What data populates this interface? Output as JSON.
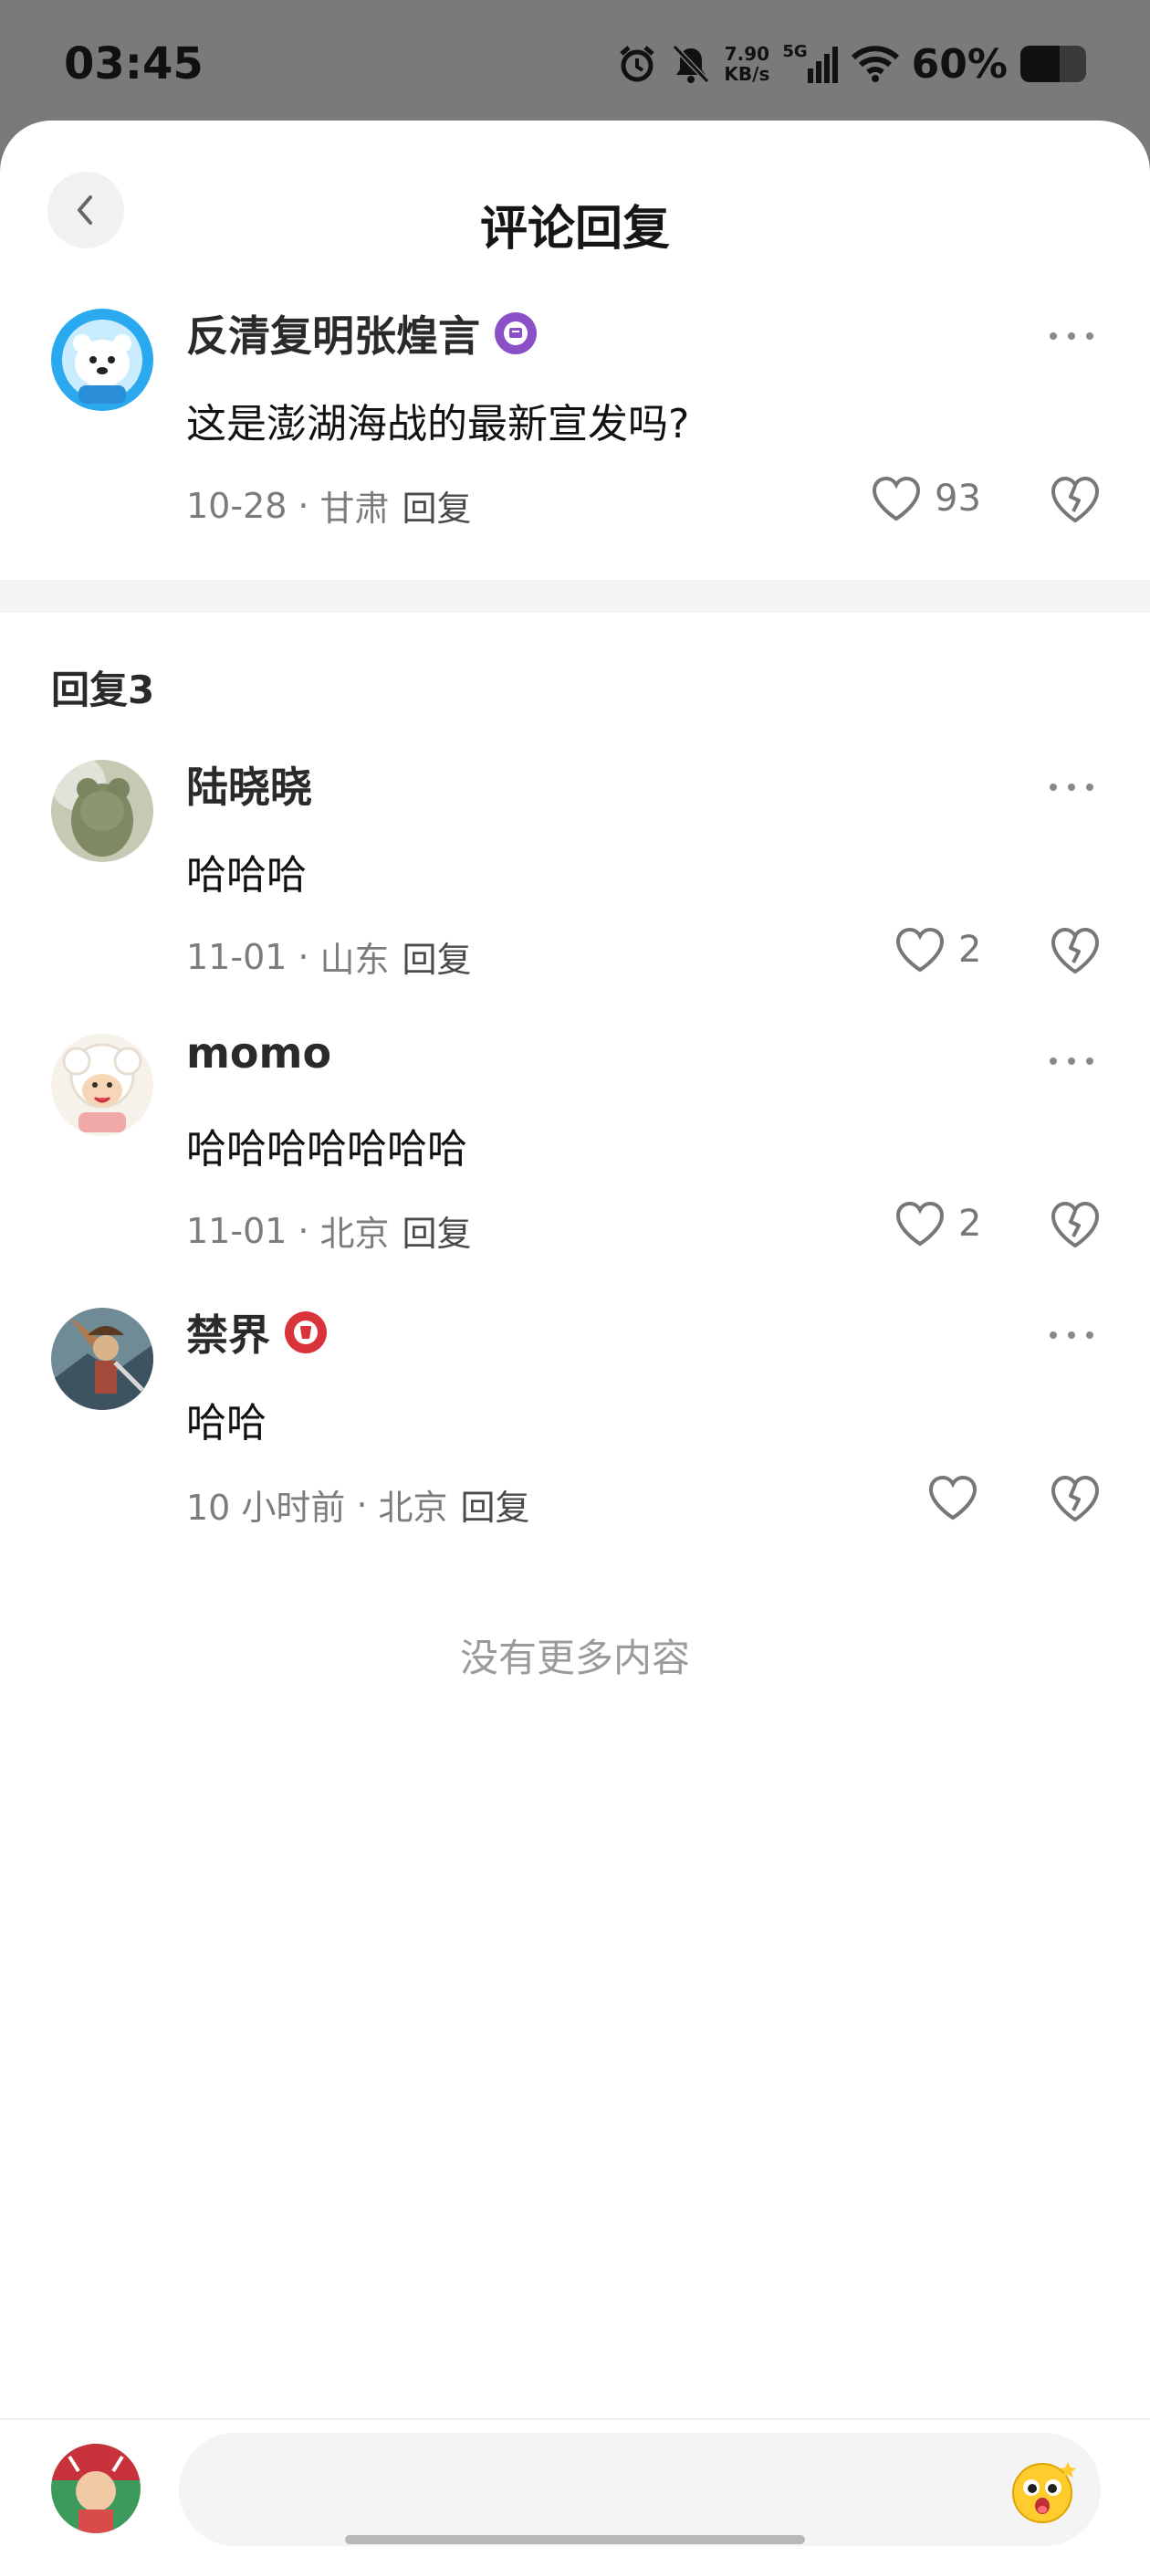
{
  "status_bar": {
    "time": "03:45",
    "net_speed_value": "7.90",
    "net_speed_unit": "KB/s",
    "signal_label": "5G",
    "battery_percent": "60%",
    "battery_level": 0.6,
    "icons": [
      "alarm-icon",
      "mute-bell-icon",
      "signal-icon",
      "wifi-icon",
      "battery-icon"
    ]
  },
  "header": {
    "title": "评论回复",
    "back_icon": "chevron-left-icon"
  },
  "main_comment": {
    "username": "反清复明张煌言",
    "badge_icon": "purple-badge-icon",
    "badge_color": "#8b4fc8",
    "text": "这是澎湖海战的最新宣发吗?",
    "date": "10-28",
    "separator": "·",
    "location": "甘肃",
    "reply_label": "回复",
    "likes": "93"
  },
  "replies_header": {
    "label": "回复3"
  },
  "replies": [
    {
      "username": "陆晓晓",
      "text": "哈哈哈",
      "date": "11-01",
      "separator": "·",
      "location": "山东",
      "reply_label": "回复",
      "likes": "2"
    },
    {
      "username": "momo",
      "text": "哈哈哈哈哈哈哈",
      "date": "11-01",
      "separator": "·",
      "location": "北京",
      "reply_label": "回复",
      "likes": "2"
    },
    {
      "username": "禁界",
      "badge_icon": "red-badge-icon",
      "badge_color": "#d9343b",
      "text": "哈哈",
      "date": "10 小时前",
      "separator": "·",
      "location": "北京",
      "reply_label": "回复",
      "likes": ""
    }
  ],
  "footer": {
    "no_more": "没有更多内容"
  },
  "input_bar": {
    "placeholder": "",
    "emoji_icon": "emoji-face-icon"
  }
}
